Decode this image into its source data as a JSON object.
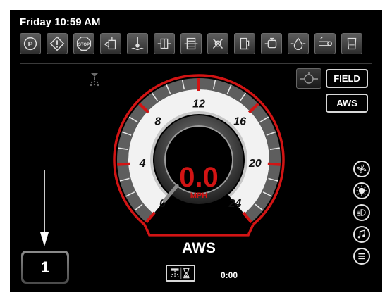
{
  "status_bar": {
    "clock": "Friday 10:59 AM"
  },
  "icon_bar": {
    "icons": [
      "parking-brake-icon",
      "warning-icon",
      "stop-icon",
      "hydraulic-icon",
      "coolant-temp-icon",
      "transmission-icon",
      "filter-icon",
      "service-icon",
      "fuel-icon",
      "engine-icon",
      "oil-icon",
      "glow-plug-icon",
      "def-fluid-icon"
    ]
  },
  "gauge": {
    "speed": "0.0",
    "unit": "MPH",
    "steer_mode": "AWS",
    "scale": {
      "min": 0,
      "max": 24,
      "labels": [
        "0",
        "4",
        "8",
        "12",
        "16",
        "20",
        "24"
      ]
    },
    "needle_value": 0
  },
  "mode_buttons": {
    "field": "FIELD",
    "aws": "AWS"
  },
  "right_controls": [
    "fan-icon",
    "light-icon",
    "headlight-icon",
    "music-icon",
    "menu-icon"
  ],
  "gear": {
    "value": "1"
  },
  "timer": {
    "value": "0:00"
  },
  "colors": {
    "accent_red": "#d21414",
    "background": "#000000",
    "text": "#ffffff"
  }
}
